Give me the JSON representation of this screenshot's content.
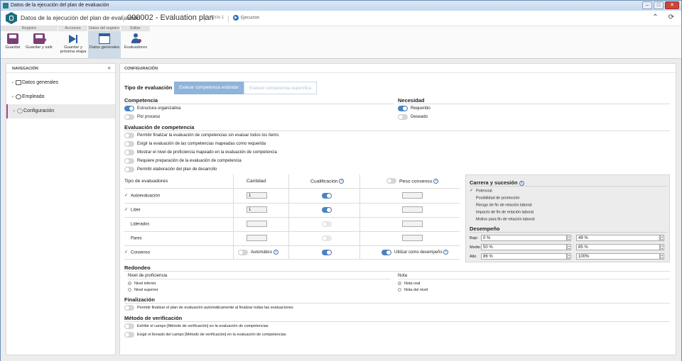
{
  "window": {
    "title": "Datos de la ejecución del plan de evaluación"
  },
  "header": {
    "title": "Datos de la ejecución del plan de evaluación",
    "doc": "000002 - Evaluation plan",
    "ciclo": "Ciclo 1",
    "status": "Ejecución"
  },
  "ribbon": {
    "groups": {
      "registro": "Registro",
      "acciones": "Acciones",
      "datos": "Datos del registro",
      "editar": "Editar"
    },
    "guardar": "Guardar",
    "guardar_salir": "Guardar y salir",
    "guardar_proxima_1": "Guardar y",
    "guardar_proxima_2": "próxima etapa",
    "datos_generales": "Datos generales",
    "evaluadores": "Evaluadores"
  },
  "nav": {
    "header": "NAVEGACIÓN",
    "collapse": "«",
    "items": [
      {
        "label": "Datos generales"
      },
      {
        "label": "Empleado"
      },
      {
        "label": "Configuración"
      }
    ]
  },
  "content": {
    "header": "CONFIGURACIÓN",
    "tipo_eval": {
      "label": "Tipo de evaluación",
      "opt1": "Evaluar competencia estándar",
      "opt2": "Evaluar competencia específica"
    },
    "competencia": {
      "title": "Competencia",
      "opt1": "Estructura organizativa",
      "opt2": "Por proceso"
    },
    "necesidad": {
      "title": "Necesidad",
      "opt1": "Requerido",
      "opt2": "Deseado"
    },
    "eval_comp": {
      "title": "Evaluación de competencia",
      "items": [
        "Permitir finalizar la evaluación de competencias sin evaluar todos los ítems",
        "Exigir la evaluación de las competencias mapeadas como requerida",
        "Mostrar el nivel de proficiencia mapeado en la evaluación de competencia",
        "Requiere preparación de la evaluación de competencia",
        "Permitir elaboración del plan de desarrollo"
      ]
    },
    "table": {
      "col_tipo": "Tipo de evaluadores",
      "col_cantidad": "Cantidad",
      "col_calif": "Cualificación",
      "col_peso": "Peso consenso",
      "rows": [
        {
          "label": "Autoevaluación",
          "cantidad": "1"
        },
        {
          "label": "Líder",
          "cantidad": "1"
        },
        {
          "label": "Liderados",
          "cantidad": ""
        },
        {
          "label": "Pares",
          "cantidad": ""
        },
        {
          "label": "Consenso",
          "cantidad": ""
        }
      ],
      "automatico": "Automático",
      "utilizar": "Utilizar como desempeño"
    },
    "carrera": {
      "title": "Carrera y sucesión",
      "items": [
        "Potencial",
        "Posibilidad de promoción",
        "Riesgo de fin de relación laboral",
        "Impacto de fin de relación laboral",
        "Motivo para fin de relación laboral"
      ]
    },
    "desempeno": {
      "title": "Desempeño",
      "rows": [
        {
          "label": "Bajo",
          "from": "0 %",
          "to": "49 %"
        },
        {
          "label": "Medio",
          "from": "50 %",
          "to": "85 %"
        },
        {
          "label": "Alto",
          "from": "86 %",
          "to": "100%"
        }
      ]
    },
    "redondeo": {
      "title": "Redondeo",
      "nivel_title": "Nivel de proficiencia",
      "nivel_opt1": "Nivel inferior",
      "nivel_opt2": "Nivel superior",
      "nota_title": "Nota",
      "nota_opt1": "Nota real",
      "nota_opt2": "Nota del nivel"
    },
    "finalizacion": {
      "title": "Finalización",
      "item": "Permitir finalizar el plan de evaluación automáticamente al finalizar todas las evaluaciones"
    },
    "metodo": {
      "title": "Método de verificación",
      "item1": "Exhibir el campo [Método de verificación] en la evaluación de competencias",
      "item2": "Exigir el llenado del campo [Método de verificación] en la evaluación de competencias"
    }
  }
}
